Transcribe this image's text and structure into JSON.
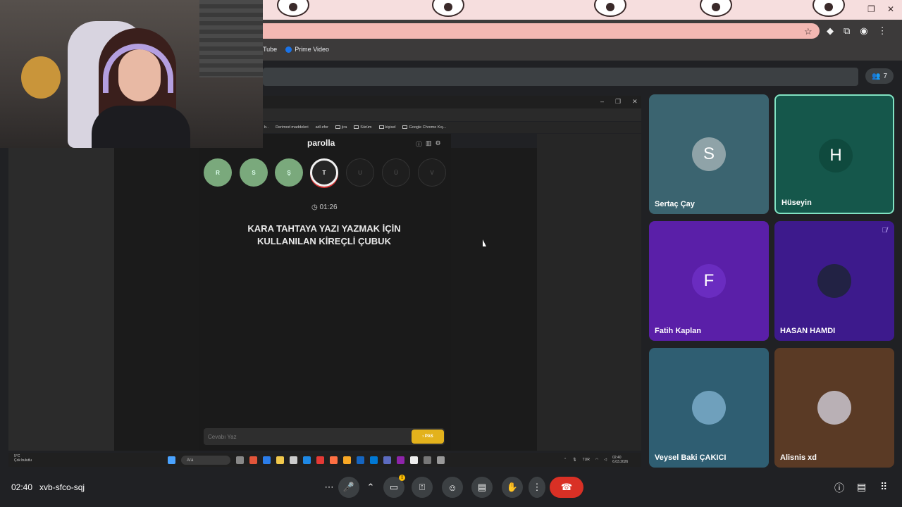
{
  "browser": {
    "bookmarks": [
      {
        "label": "Tube"
      },
      {
        "label": "Prime Video"
      }
    ],
    "window_controls": [
      "–",
      "❐",
      "✕"
    ]
  },
  "meet": {
    "people_count": "7",
    "time": "02:40",
    "meeting_code": "xvb-sfco-sqj"
  },
  "shared_screen": {
    "inner_bookmarks": [
      "b..",
      "Derimod maddeleri",
      "adl efor",
      "jira",
      "Sürüm",
      "kişisel",
      "Google Chrome Kış..."
    ],
    "game": {
      "title": "parolla",
      "letters": [
        {
          "char": "R",
          "state": "done"
        },
        {
          "char": "S",
          "state": "done"
        },
        {
          "char": "Ş",
          "state": "done"
        },
        {
          "char": "T",
          "state": "active"
        },
        {
          "char": "U",
          "state": "pending"
        },
        {
          "char": "Ü",
          "state": "pending"
        },
        {
          "char": "V",
          "state": "pending"
        }
      ],
      "timer": "01:26",
      "question_line1": "KARA TAHTAYA YAZI YAZMAK İÇİN",
      "question_line2": "KULLANILAN KİREÇLİ ÇUBUK",
      "answer_placeholder": "Cevabı Yaz",
      "pass_label": "› PAS"
    },
    "taskbar": {
      "weather_temp": "5°C",
      "weather_desc": "Çok bulutlu",
      "search_label": "Ara",
      "lang": "TUR",
      "clock_time": "02:40",
      "clock_date": "6.03.2026"
    }
  },
  "participants": [
    {
      "name": "Sertaç Çay",
      "initial": "S",
      "bg": "#3b6470",
      "avatar_bg": "#8fa3a8",
      "speaking": false
    },
    {
      "name": "Hüseyin",
      "initial": "H",
      "bg": "#15574b",
      "avatar_bg": "#0f4a3e",
      "speaking": true
    },
    {
      "name": "Fatih Kaplan",
      "initial": "F",
      "bg": "#5a1fa8",
      "avatar_bg": "#6a2cc0",
      "speaking": false
    },
    {
      "name": "HASAN HAMDI",
      "initial": "",
      "bg": "#3d1a8c",
      "avatar_bg": "#222244",
      "speaking": false,
      "muted": true
    },
    {
      "name": "Veysel Baki ÇAKICI",
      "initial": "",
      "bg": "#2f5e72",
      "avatar_bg": "#6fa0bc",
      "speaking": false
    },
    {
      "name": "Alisnis xd",
      "initial": "",
      "bg": "#5a3a25",
      "avatar_bg": "#b9b0b5",
      "speaking": false
    }
  ],
  "colors": {
    "end_call": "#d93025",
    "done_letter": "#7aa97c",
    "pass_button": "#e3b21c",
    "speaking_border": "#81e3c3"
  }
}
